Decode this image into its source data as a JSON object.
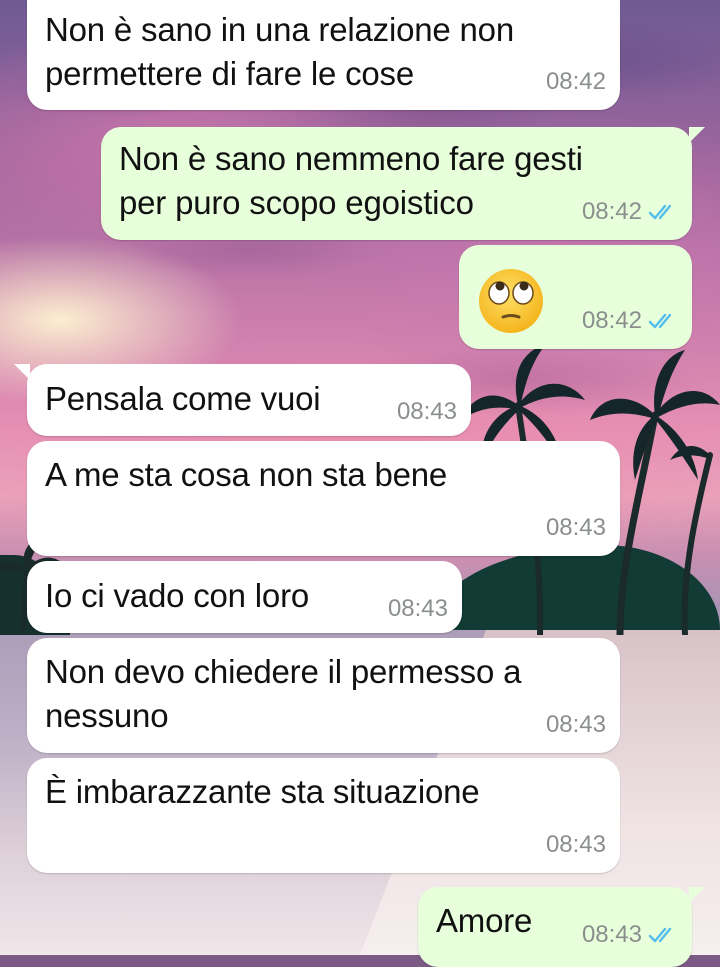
{
  "messages": [
    {
      "direction": "incoming",
      "text": "Non è sano in una relazione non\npermettere di fare le cose",
      "time": "08:42"
    },
    {
      "direction": "outgoing",
      "text": "Non è sano nemmeno fare gesti\nper puro scopo egoistico",
      "time": "08:42",
      "status": "read"
    },
    {
      "direction": "outgoing",
      "emoji": "face-with-rolling-eyes",
      "time": "08:42",
      "status": "read"
    },
    {
      "direction": "incoming",
      "text": "Pensala come vuoi",
      "time": "08:43"
    },
    {
      "direction": "incoming",
      "text": "A me sta cosa non sta bene",
      "time": "08:43"
    },
    {
      "direction": "incoming",
      "text": "Io ci vado con loro",
      "time": "08:43"
    },
    {
      "direction": "incoming",
      "text": "Non devo chiedere il permesso a\nnessuno",
      "time": "08:43"
    },
    {
      "direction": "incoming",
      "text": "È imbarazzante sta situazione",
      "time": "08:43"
    },
    {
      "direction": "outgoing",
      "text": "Amore",
      "time": "08:43",
      "status": "read"
    }
  ],
  "colors": {
    "incoming_bubble": "#ffffff",
    "outgoing_bubble": "#e7ffdb",
    "read_ticks": "#53bdeb",
    "time_text": "#8a8f8e"
  }
}
